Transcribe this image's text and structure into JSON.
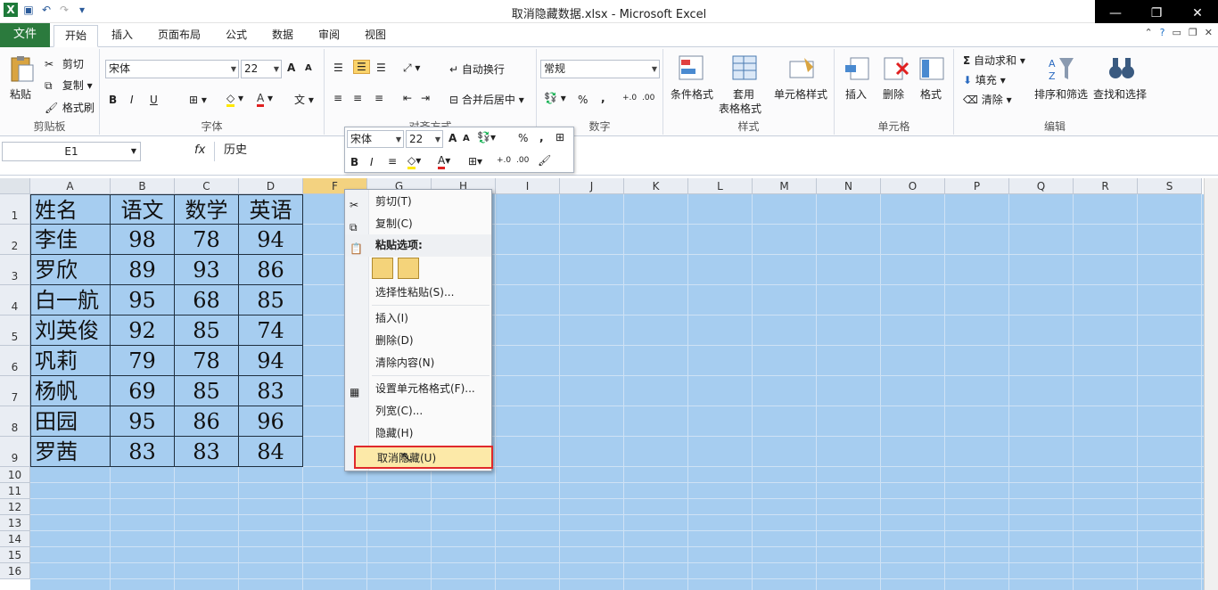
{
  "window": {
    "title": "取消隐藏数据.xlsx - Microsoft Excel",
    "controls": [
      "—",
      "❐",
      "✕"
    ]
  },
  "tabs": {
    "file": "文件",
    "items": [
      "开始",
      "插入",
      "页面布局",
      "公式",
      "数据",
      "审阅",
      "视图"
    ]
  },
  "ribbon": {
    "clipboard": {
      "label": "剪贴板",
      "paste": "粘贴",
      "cut": "剪切",
      "copy": "复制",
      "painter": "格式刷"
    },
    "font": {
      "label": "字体",
      "name": "宋体",
      "size": "22",
      "bold": "B",
      "italic": "I",
      "underline": "U",
      "grow": "A",
      "shrink": "A"
    },
    "align": {
      "label": "对齐方式",
      "wrap": "自动换行",
      "merge": "合并后居中"
    },
    "number": {
      "label": "数字",
      "format": "常规",
      "percent": "%",
      "comma": ","
    },
    "styles": {
      "label": "样式",
      "cond": "条件格式",
      "table1": "套用",
      "table2": "表格格式",
      "cell": "单元格样式"
    },
    "cells": {
      "label": "单元格",
      "insert": "插入",
      "delete": "删除",
      "format": "格式"
    },
    "edit": {
      "label": "编辑",
      "autosum": "自动求和",
      "fill": "填充",
      "clear": "清除",
      "sort": "排序和筛选",
      "find": "查找和选择"
    }
  },
  "formulabar": {
    "namebox": "E1",
    "fx": "fx",
    "value": "历史"
  },
  "sheet": {
    "columns": [
      "A",
      "B",
      "C",
      "D",
      "F",
      "G",
      "H",
      "I",
      "J",
      "K",
      "L",
      "M",
      "N",
      "O",
      "P",
      "Q",
      "R",
      "S"
    ],
    "rows": [
      "1",
      "2",
      "3",
      "4",
      "5",
      "6",
      "7",
      "8",
      "9",
      "10",
      "11",
      "12",
      "13",
      "14",
      "15",
      "16"
    ],
    "data": [
      [
        "姓名",
        "语文",
        "数学",
        "英语"
      ],
      [
        "李佳",
        "98",
        "78",
        "94"
      ],
      [
        "罗欣",
        "89",
        "93",
        "86"
      ],
      [
        "白一航",
        "95",
        "68",
        "85"
      ],
      [
        "刘英俊",
        "92",
        "85",
        "74"
      ],
      [
        "巩莉",
        "79",
        "78",
        "94"
      ],
      [
        "杨帆",
        "69",
        "85",
        "83"
      ],
      [
        "田园",
        "95",
        "86",
        "96"
      ],
      [
        "罗茜",
        "83",
        "83",
        "84"
      ]
    ]
  },
  "minitoolbar": {
    "font": "宋体",
    "size": "22",
    "percent": "%",
    "comma": ","
  },
  "contextmenu": {
    "cut": "剪切(T)",
    "copy": "复制(C)",
    "paste_options": "粘贴选项:",
    "paste_special": "选择性粘贴(S)...",
    "insert": "插入(I)",
    "delete": "删除(D)",
    "clear": "清除内容(N)",
    "format_cells": "设置单元格格式(F)...",
    "col_width": "列宽(C)...",
    "hide": "隐藏(H)",
    "unhide": "取消隐藏(U)"
  }
}
